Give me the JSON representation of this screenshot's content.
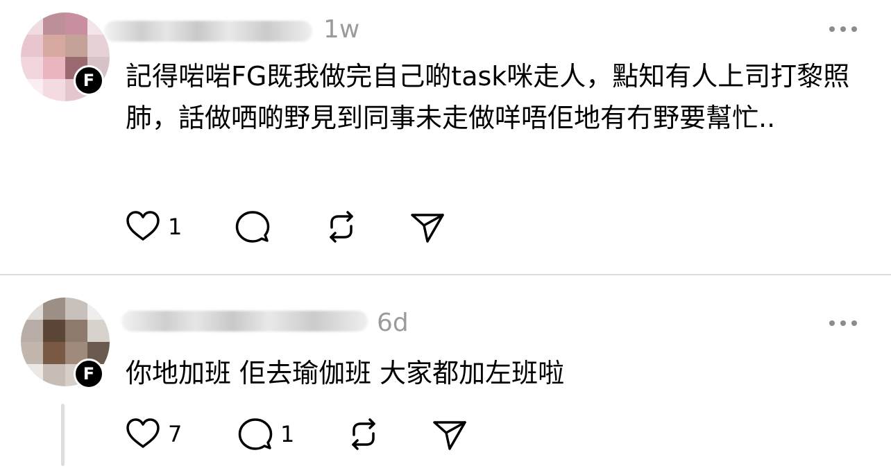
{
  "colors": {
    "text": "#000000",
    "muted": "#9b9b9b",
    "divider": "#dcdcdc",
    "thread_line": "#dedede"
  },
  "posts": [
    {
      "timestamp": "1w",
      "badge": "F",
      "text": "記得啱啱FG既我做完自己啲task咪走人，點知有人上司打黎照肺，話做哂啲野見到同事未走做咩唔佢地有冇野要幫忙..",
      "likes": "1",
      "replies": "",
      "icons": [
        "heart-icon",
        "comment-icon",
        "repost-icon",
        "share-icon",
        "more-icon"
      ]
    },
    {
      "timestamp": "6d",
      "badge": "F",
      "text": "你地加班 佢去瑜伽班 大家都加左班啦",
      "likes": "7",
      "replies": "1",
      "icons": [
        "heart-icon",
        "comment-icon",
        "repost-icon",
        "share-icon",
        "more-icon"
      ]
    }
  ]
}
